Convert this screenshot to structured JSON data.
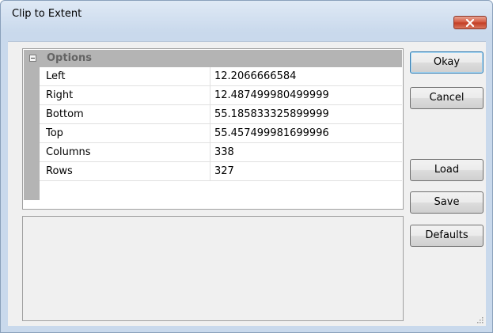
{
  "window": {
    "title": "Clip to Extent"
  },
  "grid": {
    "category": "Options",
    "properties": [
      {
        "name": "Left",
        "value": "12.2066666584"
      },
      {
        "name": "Right",
        "value": "12.487499980499999"
      },
      {
        "name": "Bottom",
        "value": "55.185833325899999"
      },
      {
        "name": "Top",
        "value": "55.457499981699996"
      },
      {
        "name": "Columns",
        "value": "338"
      },
      {
        "name": "Rows",
        "value": "327"
      }
    ]
  },
  "buttons": {
    "okay": "Okay",
    "cancel": "Cancel",
    "load": "Load",
    "save": "Save",
    "defaults": "Defaults"
  },
  "icons": {
    "close": "close-icon",
    "expander": "collapse-icon",
    "grip": "resize-grip-icon"
  },
  "colors": {
    "close_button": "#c23b22",
    "category_band": "#b4b4b4",
    "default_button_border": "#3c7fb1"
  }
}
